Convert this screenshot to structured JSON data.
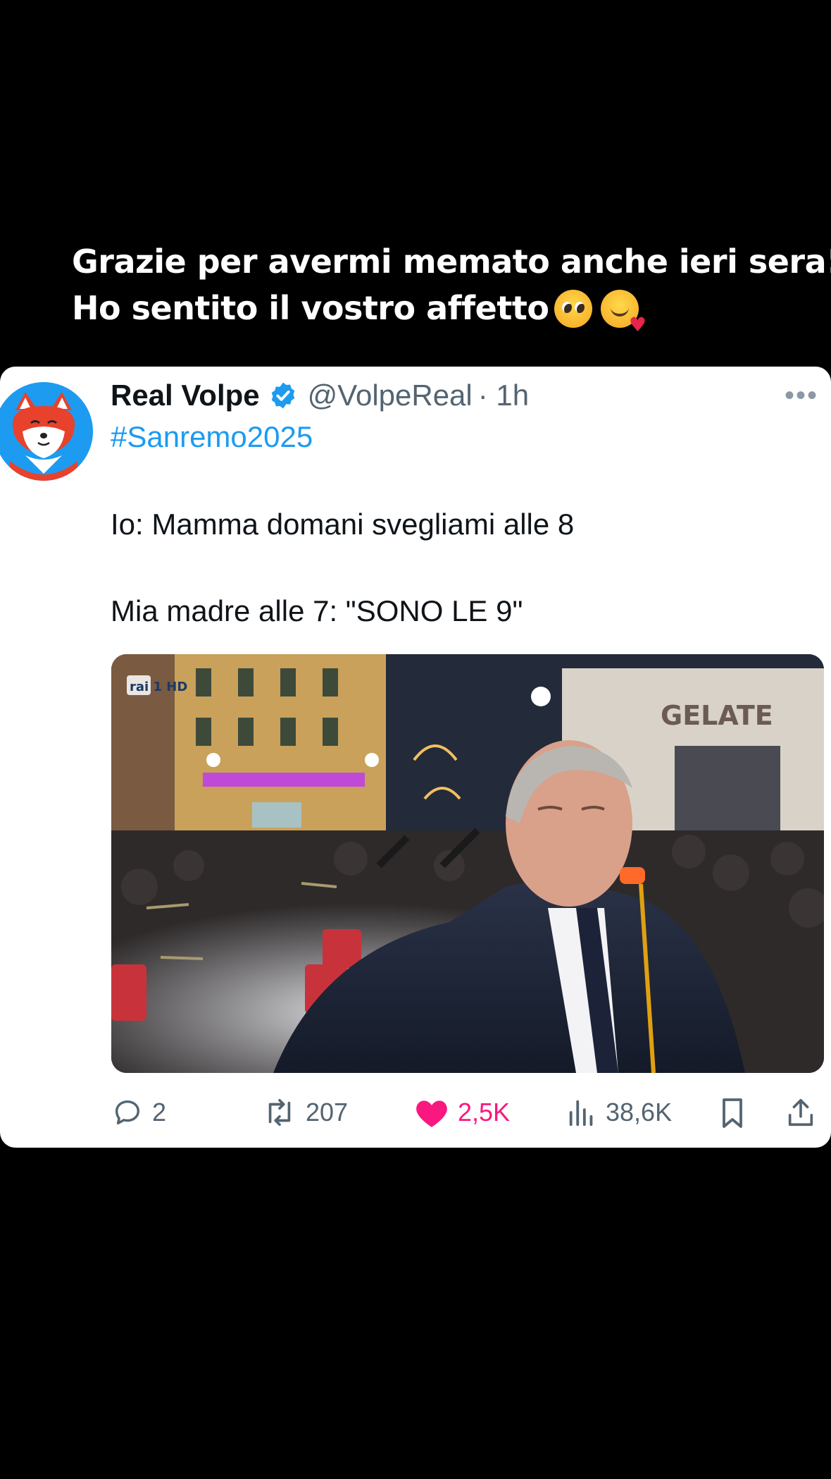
{
  "caption": {
    "line1": "Grazie per avermi memato anche ieri sera!",
    "line2": "Ho sentito il vostro affetto",
    "emojis": [
      "pleading-face-emoji",
      "smiling-face-with-hearts-emoji"
    ]
  },
  "tweet": {
    "display_name": "Real Volpe",
    "verified": true,
    "handle": "@VolpeReal",
    "time": "· 1h",
    "hashtag": "#Sanremo2025",
    "line1": "Io: Mamma domani svegliami alle 8",
    "line2": "Mia madre alle 7: \"SONO LE 9\"",
    "media": {
      "tv_logo": "rai 1 HD",
      "shop_sign": "GELATE"
    },
    "actions": {
      "replies": "2",
      "reposts": "207",
      "likes": "2,5K",
      "views": "38,6K"
    }
  },
  "colors": {
    "accent": "#1d9bf0",
    "like": "#f91880",
    "secondary_text": "#536471",
    "background": "#000000"
  }
}
